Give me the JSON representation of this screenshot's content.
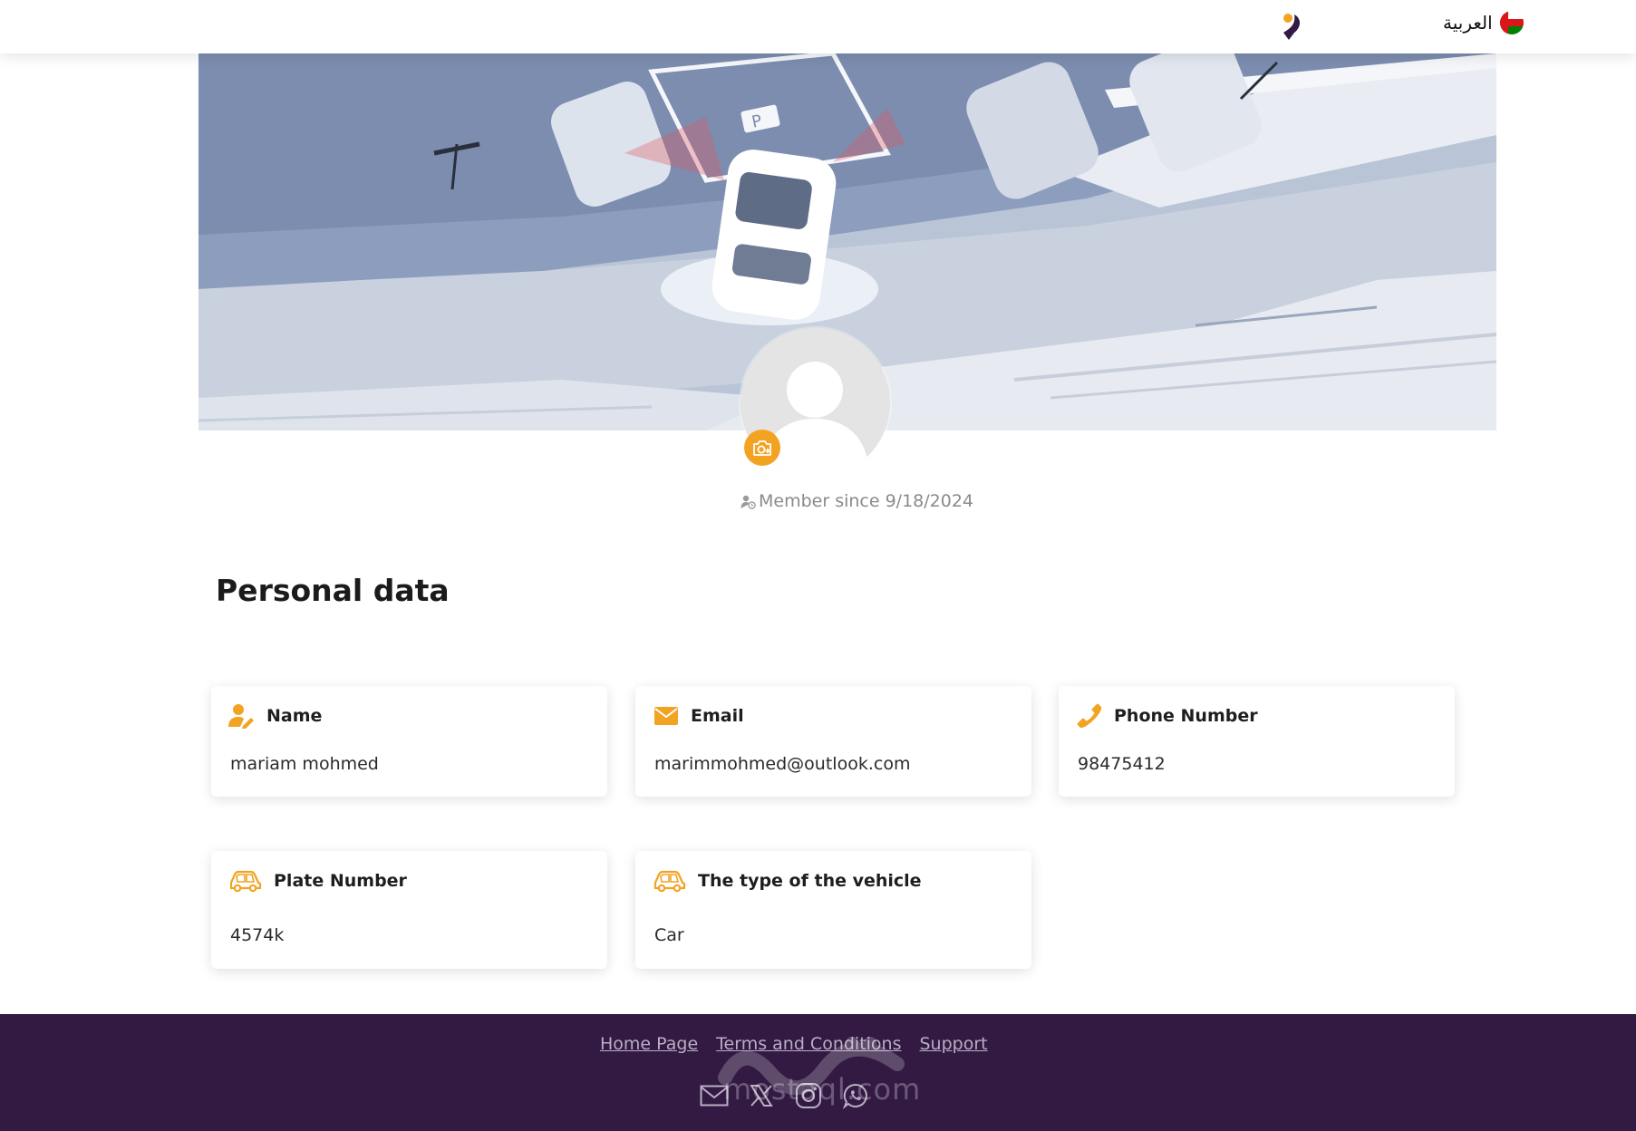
{
  "header": {
    "language_label": "العربية"
  },
  "profile": {
    "member_since": "Member since 9/18/2024"
  },
  "section": {
    "title": "Personal data"
  },
  "cards": [
    {
      "label": "Name",
      "value": "mariam mohmed",
      "icon": "user-edit-icon"
    },
    {
      "label": "Email",
      "value": "marimmohmed@outlook.com",
      "icon": "envelope-icon"
    },
    {
      "label": "Phone Number",
      "value": "98475412",
      "icon": "phone-icon"
    },
    {
      "label": "Plate Number",
      "value": "4574k",
      "icon": "car-icon"
    },
    {
      "label": "The type of the vehicle",
      "value": "Car",
      "icon": "car-icon"
    }
  ],
  "footer": {
    "links": [
      "Home Page",
      "Terms and Conditions",
      "Support"
    ],
    "social": [
      "mail-icon",
      "x-icon",
      "instagram-icon",
      "whatsapp-icon"
    ],
    "watermark_text": "mostaql.com"
  },
  "colors": {
    "accent": "#f2a322",
    "footer_bg": "#321a43",
    "footer_link": "#b9aec3"
  }
}
